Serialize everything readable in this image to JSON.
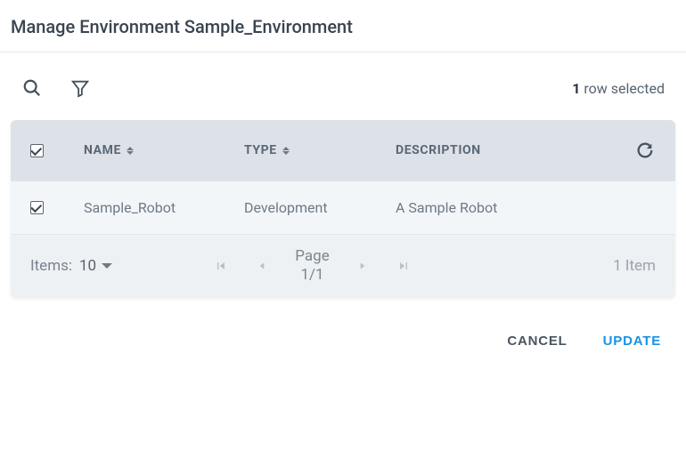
{
  "header": {
    "title": "Manage Environment Sample_Environment"
  },
  "toolbar": {
    "selected_count": "1",
    "row_selected_label": "row selected"
  },
  "table": {
    "columns": {
      "name": "NAME",
      "type": "TYPE",
      "description": "DESCRIPTION"
    },
    "rows": [
      {
        "checked": true,
        "name": "Sample_Robot",
        "type": "Development",
        "description": "A Sample Robot"
      }
    ],
    "footer": {
      "items_label": "Items:",
      "items_per_page": "10",
      "page_label_top": "Page",
      "page_label_bottom": "1/1",
      "item_count": "1 Item"
    }
  },
  "actions": {
    "cancel": "CANCEL",
    "update": "UPDATE"
  }
}
